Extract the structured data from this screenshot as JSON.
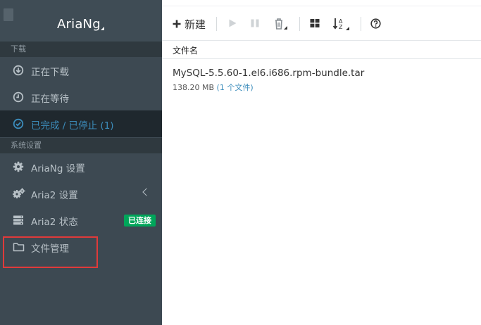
{
  "sidebar": {
    "brand": "AriaNg",
    "sections": {
      "download": "下载",
      "settings": "系统设置"
    },
    "items": [
      {
        "label": "正在下载",
        "icon": "arrow-down-circle-icon"
      },
      {
        "label": "正在等待",
        "icon": "clock-icon"
      },
      {
        "label": "已完成 / 已停止 (1)",
        "icon": "check-circle-icon"
      },
      {
        "label": "AriaNg 设置",
        "icon": "gear-icon"
      },
      {
        "label": "Aria2 设置",
        "icon": "gears-icon"
      },
      {
        "label": "Aria2 状态",
        "icon": "server-icon",
        "badge": "已连接"
      },
      {
        "label": "文件管理",
        "icon": "folder-icon"
      }
    ]
  },
  "toolbar": {
    "new_label": "新建"
  },
  "table": {
    "column_filename": "文件名"
  },
  "tasks": [
    {
      "name": "MySQL-5.5.60-1.el6.i686.rpm-bundle.tar",
      "size": "138.20 MB",
      "files": "(1 个文件)"
    }
  ],
  "colors": {
    "sidebar_bg": "#3d4952",
    "active_bg": "#1f282e",
    "accent": "#3c8dbc",
    "badge": "#00a65a",
    "highlight": "#e03a3a"
  }
}
